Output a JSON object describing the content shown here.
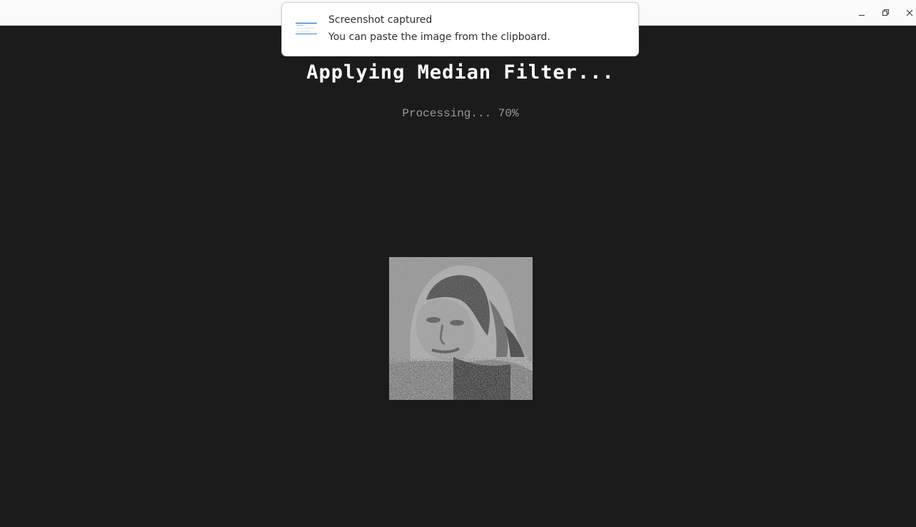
{
  "window": {
    "controls": {
      "minimize_icon": "minimize-icon",
      "maximize_icon": "restore-icon",
      "close_icon": "close-icon"
    }
  },
  "notification": {
    "title": "Screenshot captured",
    "body": "You can paste the image from the clipboard.",
    "icon": "screenshot-thumbnail-icon"
  },
  "main": {
    "heading": "Applying Median Filter...",
    "status": "Processing... 70%",
    "progress": 0.7
  },
  "colors": {
    "background": "#1b1b1b",
    "heading": "#ffffff",
    "status": "#9a9a9a",
    "titlebar": "#fafafa",
    "accent": "#3584e4"
  }
}
